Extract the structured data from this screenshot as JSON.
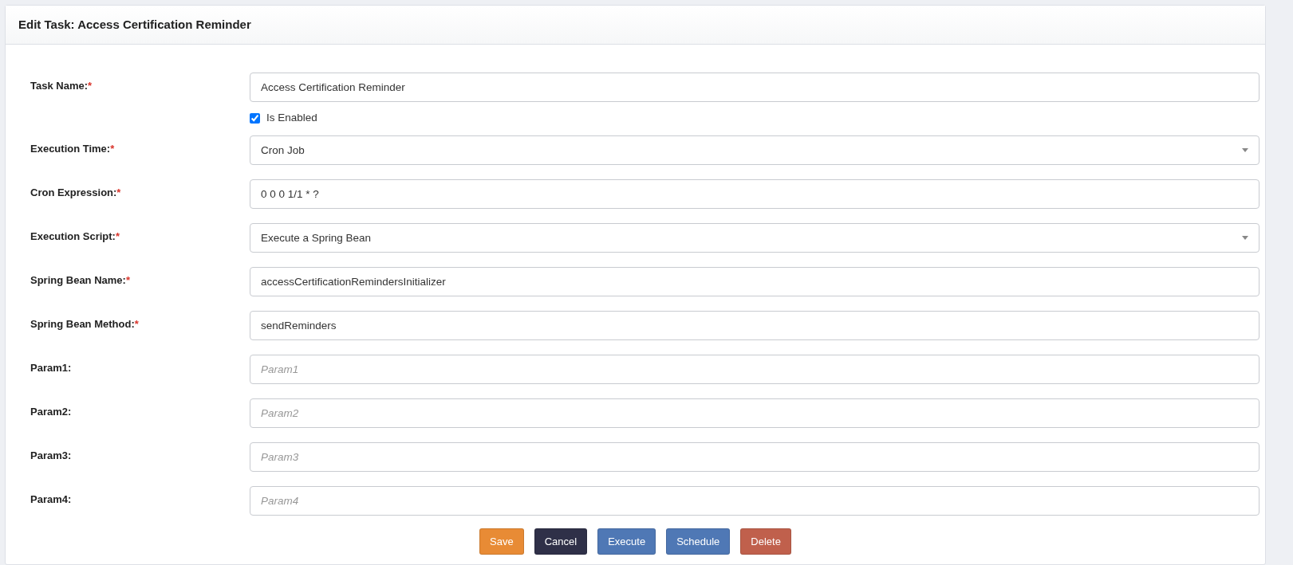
{
  "title": "Edit Task: Access Certification Reminder",
  "fields": [
    {
      "kind": "text",
      "label": "Task Name:",
      "required_mark": "*",
      "value": "Access Certification Reminder"
    },
    {
      "kind": "checkbox",
      "label": "Is Enabled",
      "checked": true
    },
    {
      "kind": "select",
      "label": "Execution Time:",
      "required_mark": "*",
      "value": "Cron Job"
    },
    {
      "kind": "text",
      "label": "Cron Expression:",
      "required_mark": "*",
      "value": "0 0 0 1/1 * ?"
    },
    {
      "kind": "select",
      "label": "Execution Script:",
      "required_mark": "*",
      "value": "Execute a Spring Bean"
    },
    {
      "kind": "text",
      "label": "Spring Bean Name:",
      "required_mark": "*",
      "value": "accessCertificationRemindersInitializer"
    },
    {
      "kind": "text",
      "label": "Spring Bean Method:",
      "required_mark": "*",
      "value": "sendReminders"
    },
    {
      "kind": "text",
      "label": "Param1:",
      "placeholder": "Param1"
    },
    {
      "kind": "text",
      "label": "Param2:",
      "placeholder": "Param2"
    },
    {
      "kind": "text",
      "label": "Param3:",
      "placeholder": "Param3"
    },
    {
      "kind": "text",
      "label": "Param4:",
      "placeholder": "Param4"
    }
  ],
  "buttons": [
    {
      "label": "Save",
      "color": "#e88b35"
    },
    {
      "label": "Cancel",
      "color": "#2f3048"
    },
    {
      "label": "Execute",
      "color": "#4f78b5"
    },
    {
      "label": "Schedule",
      "color": "#4f78b5"
    },
    {
      "label": "Delete",
      "color": "#c0604c"
    }
  ]
}
